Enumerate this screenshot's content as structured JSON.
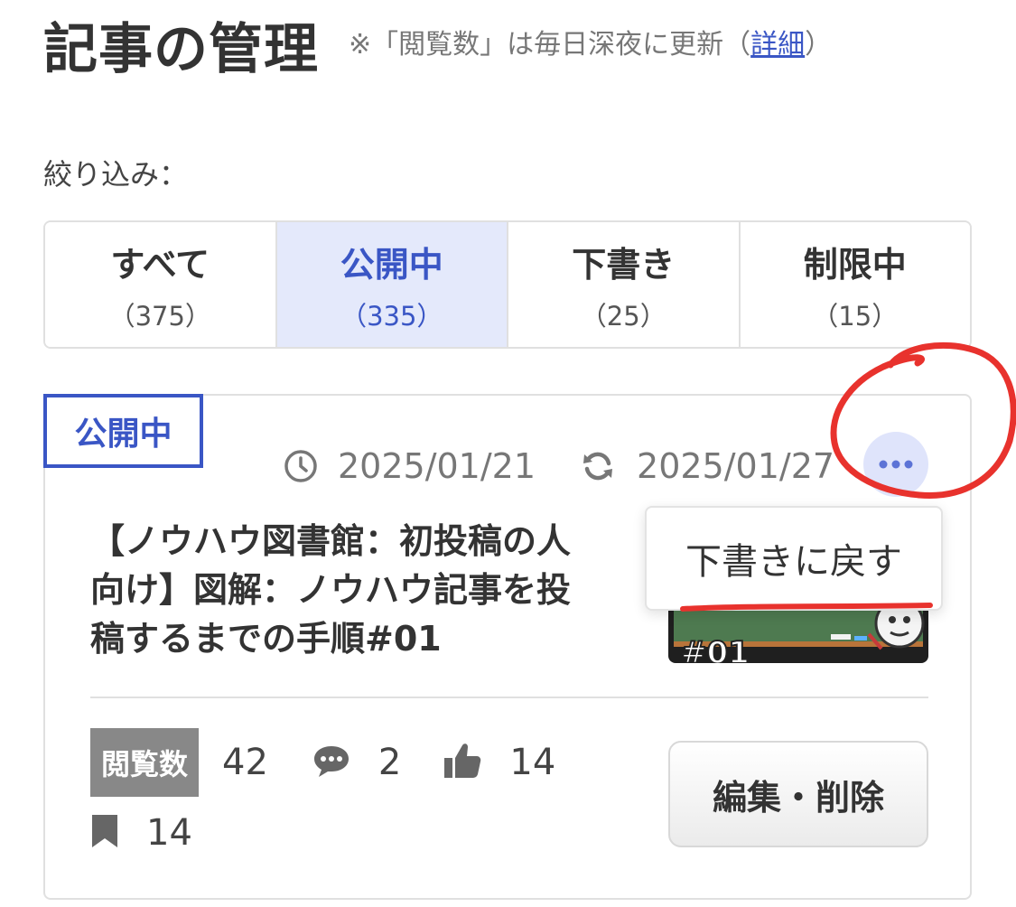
{
  "header": {
    "title": "記事の管理",
    "note_prefix": "※「閲覧数」は毎日深夜に更新（",
    "note_link": "詳細",
    "note_suffix": "）"
  },
  "filter": {
    "label": "絞り込み：",
    "tabs": [
      {
        "label": "すべて",
        "count": "（375）"
      },
      {
        "label": "公開中",
        "count": "（335）"
      },
      {
        "label": "下書き",
        "count": "（25）"
      },
      {
        "label": "制限中",
        "count": "（15）"
      }
    ],
    "active_tab": "公開中"
  },
  "article": {
    "status": "公開中",
    "published_date": "2025/01/21",
    "updated_date": "2025/01/27",
    "title_lines": [
      "【ノウハウ図書館：初投稿の人",
      "向け】図解：ノウハウ記事を投",
      "稿するまでの手順#01"
    ],
    "thumbnail_text": "#01",
    "stats": {
      "views_label": "閲覧数",
      "views": "42",
      "comments": "2",
      "likes": "14",
      "bookmarks": "14"
    },
    "edit_delete_label": "編集・削除"
  },
  "dropdown": {
    "items": [
      {
        "label": "下書きに戻す"
      }
    ]
  },
  "icons": {
    "published": "clock-icon",
    "updated": "refresh-icon",
    "more": "ellipsis-icon",
    "comments": "speech-bubble-icon",
    "likes": "thumbs-up-icon",
    "bookmarks": "bookmark-icon"
  },
  "colors": {
    "accent": "#3a56c5",
    "active_tab_bg": "#e4e9fb",
    "more_button_bg": "#dfe4fb",
    "views_badge_bg": "#888888",
    "annotation": "#e8322d"
  }
}
